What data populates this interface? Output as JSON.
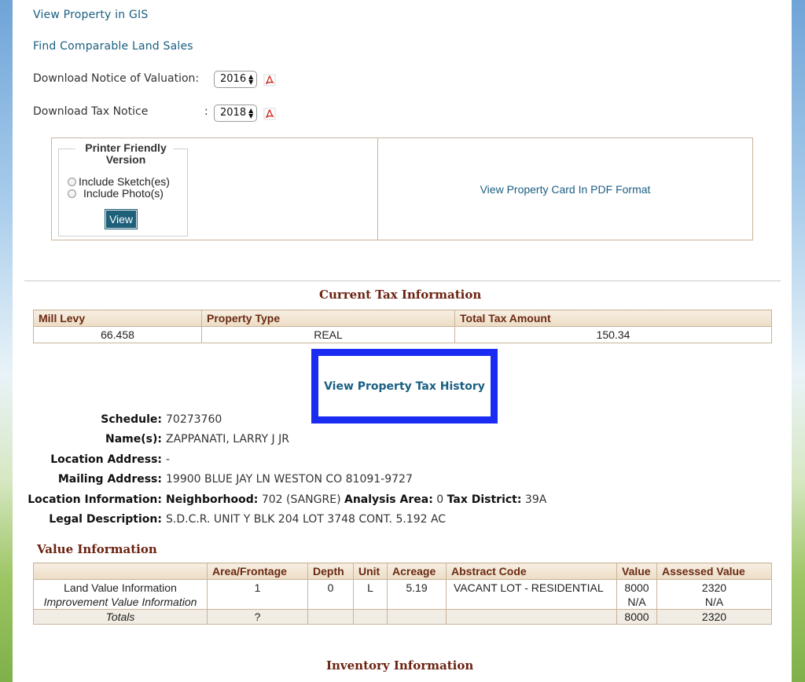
{
  "links": {
    "gis": "View Property in GIS",
    "comparable": "Find Comparable Land Sales"
  },
  "downloads": {
    "valuation_label": "Download Notice of Valuation:",
    "valuation_year": "2016",
    "tax_label": "Download Tax Notice",
    "tax_colon": ":",
    "tax_year": "2018"
  },
  "printer": {
    "legend": "Printer Friendly Version",
    "option_sketch": "Include Sketch(es)",
    "option_photo": "Include Photo(s)",
    "view_button": "View",
    "pdf_link": "View Property Card In PDF Format"
  },
  "current_tax": {
    "title": "Current Tax Information",
    "headers": [
      "Mill Levy",
      "Property Type",
      "Total Tax Amount"
    ],
    "mill_levy": "66.458",
    "property_type": "REAL",
    "total_tax": "150.34",
    "history_link": "View Property Tax History"
  },
  "property": {
    "schedule_label": "Schedule:",
    "schedule": "70273760",
    "names_label": "Name(s):",
    "names": "ZAPPANATI, LARRY J JR",
    "location_address_label": "Location Address:",
    "location_address": "-",
    "mailing_label": "Mailing Address:",
    "mailing": "19900 BLUE JAY LN WESTON CO 81091-9727",
    "location_info_label": "Location Information:",
    "neighborhood_label": "Neighborhood:",
    "neighborhood": "702 (SANGRE)",
    "analysis_label": "Analysis Area:",
    "analysis": "0",
    "district_label": "Tax District:",
    "district": "39A",
    "legal_label": "Legal Description:",
    "legal": "S.D.C.R. UNIT Y BLK 204 LOT 3748 CONT. 5.192 AC"
  },
  "value_info": {
    "title": "Value Information",
    "headers": [
      "",
      "Area/Frontage",
      "Depth",
      "Unit",
      "Acreage",
      "Abstract Code",
      "Value",
      "Assessed Value"
    ],
    "land": {
      "label": "Land Value Information",
      "area": "1",
      "depth": "0",
      "unit": "L",
      "acreage": "5.19",
      "code": "VACANT LOT - RESIDENTIAL",
      "value": "8000",
      "assessed": "2320"
    },
    "improvement": {
      "label": "Improvement Value Information",
      "value": "N/A",
      "assessed": "N/A"
    },
    "totals": {
      "label": "Totals",
      "area": "?",
      "value": "8000",
      "assessed": "2320"
    }
  },
  "inventory": {
    "title": "Inventory Information"
  },
  "colors": {
    "link": "#1a5e82",
    "section_title": "#6b2210",
    "highlight": "#1a2cf2",
    "button": "#1e5f7a"
  }
}
